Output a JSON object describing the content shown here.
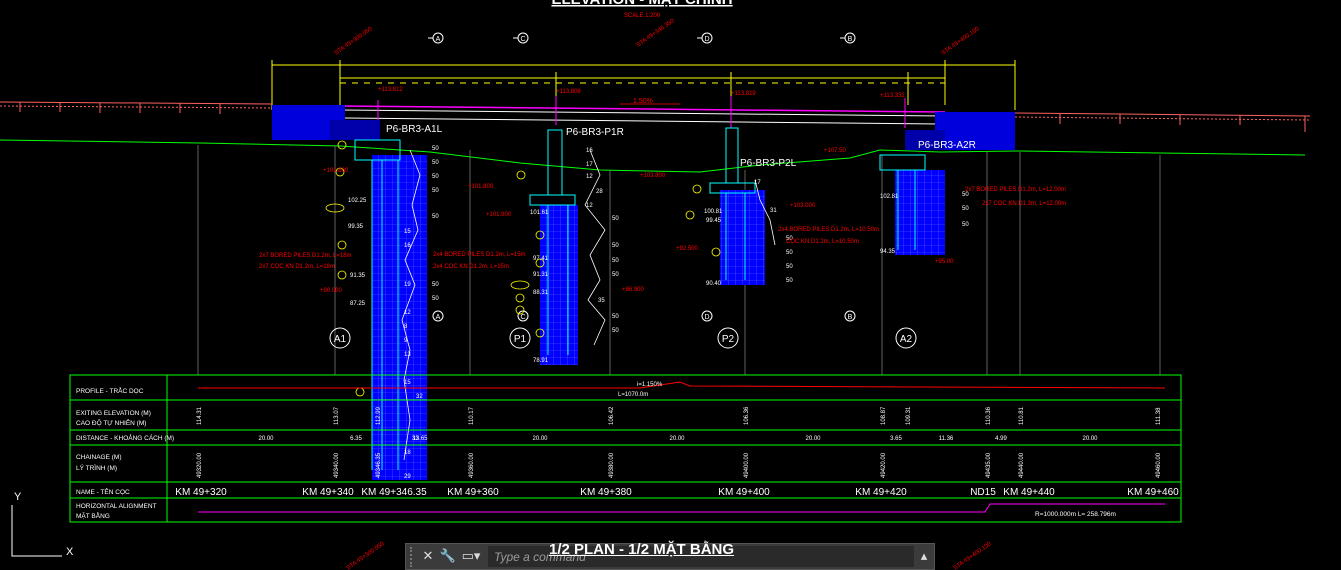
{
  "drawing": {
    "title_top": "ELEVATION - MẶT CHÍNH",
    "scale_top": "SCALE 1:200",
    "plan_title": "1/2 PLAN - 1/2 MẶT BẰNG",
    "axes": [
      "A",
      "C",
      "D",
      "B"
    ],
    "top_stations": [
      "STA 49+300.050",
      "STA 49+346.350",
      "STA 49+400.100"
    ],
    "span_marks": [
      "+113.812",
      "+113.808",
      "+113.819",
      "+113.332"
    ],
    "slope_label": "1.50%",
    "pier_labels": [
      "P6-BR3-A1L",
      "P6-BR3-P1R",
      "P6-BR3-P2L",
      "P6-BR3-A2R"
    ],
    "support_circles": [
      "A1",
      "P1",
      "P2",
      "A2"
    ],
    "pile_notes": [
      "2x7 BORED PILES D1.2m, L=18m",
      "2x7 CỌC KN D1.2m, L=18m",
      "2x4 BORED PILES D1.2m, L=15m",
      "2x4 CỌC KN D1.2m, L=15m",
      "2x4 BORED PILES D1.2m, L=10.50m",
      "CỌC KN D1.2m, L=10.50m",
      "2x7 BORED PILES D1.2m, L=12.00m",
      "2x7 CỌC KN D1.2m, L=12.00m"
    ],
    "elev_notes_left": [
      "+101.800",
      "102.25",
      "99.35",
      "91.35",
      "87.25",
      "+90.000"
    ],
    "elev_notes_p1": [
      "+101.800",
      "+101.900",
      "101.61",
      "97.41",
      "91.31",
      "88.31",
      "+86.900",
      "78.91"
    ],
    "elev_notes_p2": [
      "+103.800",
      "100.81",
      "99.45",
      "+92.500",
      "90.40",
      "+103.000"
    ],
    "elev_notes_a2": [
      "+107.50",
      "102.81",
      "94.35",
      "+95.00"
    ],
    "spt": [
      "50",
      "50",
      "50",
      "50",
      "50",
      "15",
      "16",
      "12",
      "8",
      "9",
      "12",
      "17",
      "19",
      "13",
      "15",
      "14",
      "32",
      "33",
      "35",
      "18",
      "22",
      "29",
      "31",
      "17",
      "28",
      "12"
    ]
  },
  "profile_table": {
    "rows": [
      "PROFILE - TRẮC DỌC",
      "EXITING ELEVATION (M)\nCAO ĐỘ TỰ NHIÊN (M)",
      "DISTANCE - KHOẢNG CÁCH (M)",
      "CHAINAGE (M)\nLÝ TRÌNH (M)",
      "NAME - TÊN CỌC",
      "HORIZONTAL ALIGNMENT\nMẶT BẰNG"
    ],
    "profile_note": "i=1.150%",
    "profile_note2": "L=1070.0m",
    "elevations": [
      "114.31",
      "113.07",
      "112.99",
      "110.17",
      "106.42",
      "106.36",
      "108.87",
      "109.31",
      "110.36",
      "110.81",
      "111.38"
    ],
    "distances": [
      "20.00",
      "6.35",
      "13.65",
      "20.00",
      "20.00",
      "20.00",
      "3.65",
      "11.36",
      "4.99",
      "20.00"
    ],
    "chainages": [
      "49320.00",
      "49340.00",
      "49346.35",
      "49360.00",
      "49380.00",
      "49400.00",
      "49420.00",
      "49435.00",
      "49440.00",
      "49460.00"
    ],
    "names": [
      "KM 49+320",
      "KM 49+340",
      "KM 49+346.35",
      "KM 49+360",
      "KM 49+380",
      "KM 49+400",
      "KM 49+420",
      "ND15",
      "KM 49+440",
      "KM 49+460"
    ],
    "alignment_note": "R=1000.000m  L= 258.796m"
  },
  "ucs": {
    "y": "Y",
    "x": "X"
  },
  "command_line": {
    "placeholder": "Type a command",
    "overlay_title": "1/2 PLAN - 1/2 MẶT BẰNG"
  },
  "colors": {
    "background": "#000000",
    "green": "#00ff00",
    "red": "#ff0000",
    "yellow": "#ffff00",
    "cyan": "#00ffff",
    "blue": "#0000ff",
    "magenta": "#ff00ff",
    "white": "#ffffff"
  }
}
